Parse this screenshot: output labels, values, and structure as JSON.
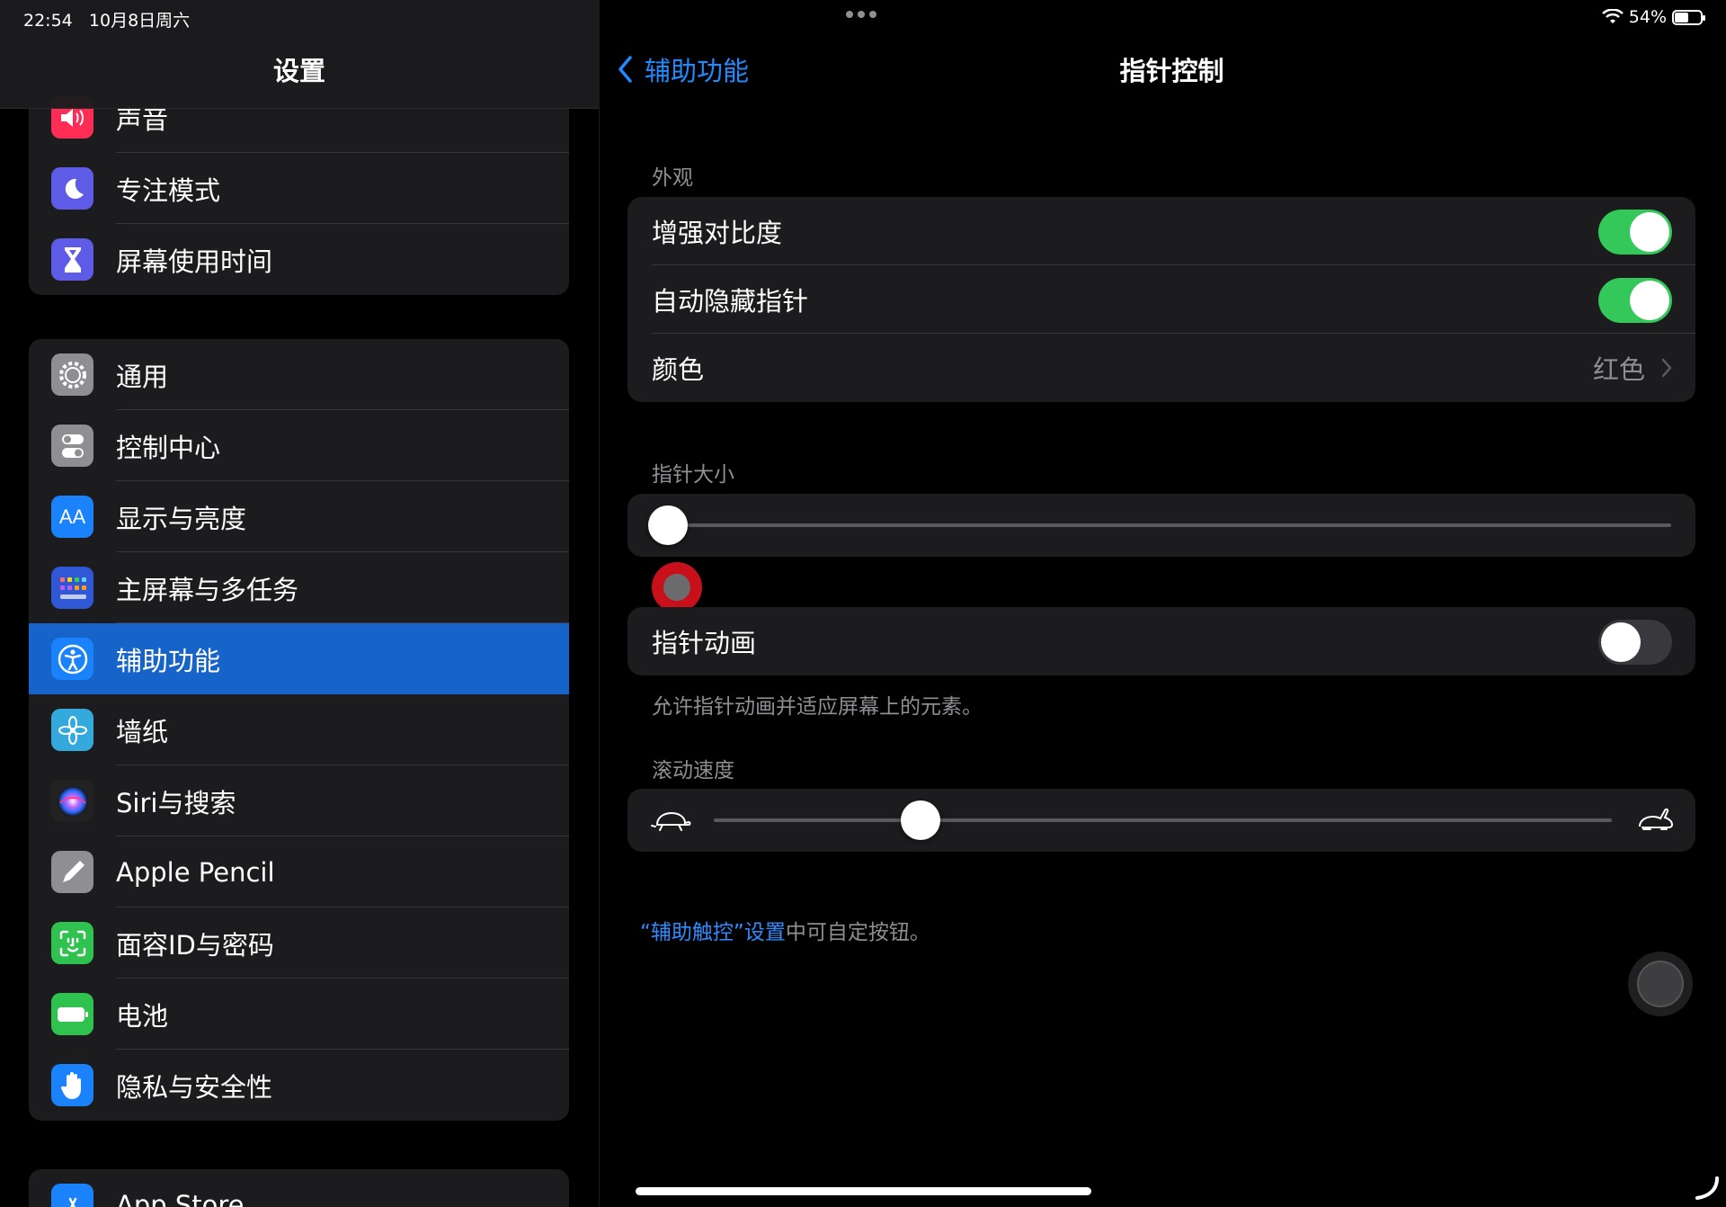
{
  "status": {
    "time": "22:54",
    "date": "10月8日周六",
    "battery_pct": "54%",
    "battery_level": 0.54
  },
  "sidebar": {
    "title": "设置",
    "group1": [
      {
        "label": "声音",
        "icon": "speaker-icon",
        "color": "#ff2d55"
      },
      {
        "label": "专注模式",
        "icon": "moon-icon",
        "color": "#5e5ce6"
      },
      {
        "label": "屏幕使用时间",
        "icon": "hourglass-icon",
        "color": "#5e5ce6"
      }
    ],
    "group2": [
      {
        "label": "通用",
        "icon": "gear-icon",
        "color": "#8e8e93"
      },
      {
        "label": "控制中心",
        "icon": "toggles-icon",
        "color": "#8e8e93"
      },
      {
        "label": "显示与亮度",
        "icon": "text-size-icon",
        "color": "#1a82fb"
      },
      {
        "label": "主屏幕与多任务",
        "icon": "grid-icon",
        "color": "#2f57d6"
      },
      {
        "label": "辅助功能",
        "icon": "accessibility-icon",
        "color": "#1a82fb",
        "selected": true
      },
      {
        "label": "墙纸",
        "icon": "flower-icon",
        "color": "#34aadc"
      },
      {
        "label": "Siri与搜索",
        "icon": "siri-icon",
        "color": "#222222"
      },
      {
        "label": "Apple Pencil",
        "icon": "pencil-icon",
        "color": "#8e8e93"
      },
      {
        "label": "面容ID与密码",
        "icon": "faceid-icon",
        "color": "#30c24f"
      },
      {
        "label": "电池",
        "icon": "battery-icon",
        "color": "#30c24f"
      },
      {
        "label": "隐私与安全性",
        "icon": "hand-icon",
        "color": "#1a82fb"
      }
    ],
    "group3": [
      {
        "label": "App Store",
        "icon": "app-store-icon",
        "color": "#1a82fb"
      }
    ]
  },
  "detail": {
    "back_label": "辅助功能",
    "title": "指针控制",
    "appearance_header": "外观",
    "appearance_rows": [
      {
        "label": "增强对比度",
        "toggle": true
      },
      {
        "label": "自动隐藏指针",
        "toggle": true
      },
      {
        "label": "颜色",
        "value": "红色"
      }
    ],
    "pointer_size_header": "指针大小",
    "pointer_size_value": 0.0,
    "animation_row": {
      "label": "指针动画",
      "toggle": false
    },
    "animation_footnote": "允许指针动画并适应屏幕上的元素。",
    "scroll_speed_header": "滚动速度",
    "scroll_speed_value": 0.23,
    "assistive_link": "“辅助触控”设置",
    "assistive_suffix": "中可自定按钮。"
  }
}
